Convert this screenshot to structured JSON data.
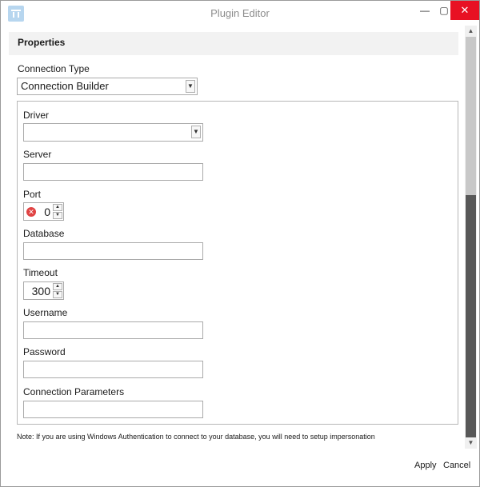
{
  "window": {
    "title": "Plugin Editor",
    "min_glyph": "—",
    "max_glyph": "▢",
    "close_glyph": "✕"
  },
  "properties": {
    "header": "Properties",
    "connection_type_label": "Connection Type",
    "connection_type_value": "Connection Builder"
  },
  "form": {
    "driver_label": "Driver",
    "driver_value": "",
    "server_label": "Server",
    "server_value": "",
    "port_label": "Port",
    "port_value": "0",
    "database_label": "Database",
    "database_value": "",
    "timeout_label": "Timeout",
    "timeout_value": "300",
    "username_label": "Username",
    "username_value": "",
    "password_label": "Password",
    "password_value": "",
    "connection_parameters_label": "Connection Parameters",
    "connection_parameters_value": ""
  },
  "note": "Note: If you are using Windows Authentication to connect to your database, you will need to setup impersonation",
  "footer": {
    "apply_label": "Apply",
    "cancel_label": "Cancel"
  },
  "icons": {
    "app": "plugin-icon",
    "dropdown": "chevron-down-icon",
    "error": "error-icon",
    "spin_up": "chevron-up-icon",
    "spin_down": "chevron-down-icon"
  },
  "colors": {
    "close_button": "#e81123",
    "error": "#e04343",
    "header_bg": "#f2f2f2",
    "scroll_thumb": "#585858"
  }
}
